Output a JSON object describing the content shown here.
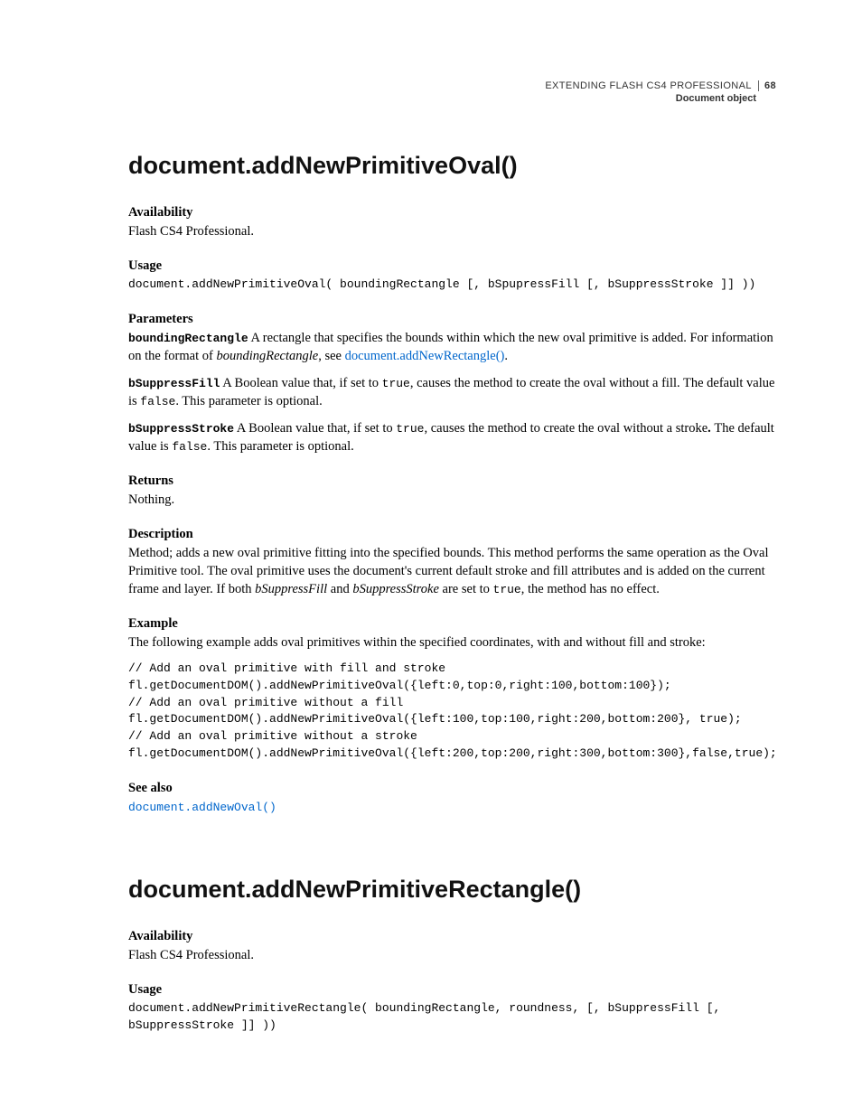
{
  "header": {
    "book_title": "EXTENDING FLASH CS4 PROFESSIONAL",
    "page_number": "68",
    "section": "Document object"
  },
  "method1": {
    "title": "document.addNewPrimitiveOval()",
    "availability_label": "Availability",
    "availability_text": "Flash CS4 Professional.",
    "usage_label": "Usage",
    "usage_code": "document.addNewPrimitiveOval( boundingRectangle [, bSpupressFill [, bSuppressStroke ]] ))",
    "parameters_label": "Parameters",
    "param1_name": "boundingRectangle",
    "param1_text_a": "  A rectangle that specifies the bounds within which the new oval primitive is added. For information on the format of ",
    "param1_boundingRect_ital": "boundingRectangle",
    "param1_text_b": ", see ",
    "param1_link": "document.addNewRectangle()",
    "param1_text_c": ".",
    "param2_name": "bSuppressFill",
    "param2_text_a": "  A Boolean value that, if set to ",
    "param2_true": "true",
    "param2_text_b": ", causes the method to create the oval without a fill. The default value is ",
    "param2_false": "false",
    "param2_text_c": ". This parameter is optional.",
    "param3_name": "bSuppressStroke",
    "param3_text_a": "  A Boolean value that, if set to ",
    "param3_true": "true",
    "param3_text_b": ", causes the method to create the oval without a stroke",
    "param3_period": ". ",
    "param3_text_c": "The default value is ",
    "param3_false": "false",
    "param3_text_d": ". This parameter is optional.",
    "returns_label": "Returns",
    "returns_text": "Nothing.",
    "description_label": "Description",
    "description_text_a": "Method; adds a new oval primitive fitting into the specified bounds. This method performs the same operation as the Oval Primitive tool. The oval primitive uses the document's current default stroke and fill attributes and is added on the current frame and layer. If both ",
    "description_ital1": "bSuppressFill",
    "description_text_b": " and ",
    "description_ital2": "bSuppressStroke",
    "description_text_c": " are set to ",
    "description_true": "true",
    "description_text_d": ", the method has no effect.",
    "example_label": "Example",
    "example_intro": "The following example adds oval primitives within the specified coordinates, with and without fill and stroke:",
    "example_code": "// Add an oval primitive with fill and stroke\nfl.getDocumentDOM().addNewPrimitiveOval({left:0,top:0,right:100,bottom:100});\n// Add an oval primitive without a fill\nfl.getDocumentDOM().addNewPrimitiveOval({left:100,top:100,right:200,bottom:200}, true);\n// Add an oval primitive without a stroke\nfl.getDocumentDOM().addNewPrimitiveOval({left:200,top:200,right:300,bottom:300},false,true);",
    "seealso_label": "See also",
    "seealso_link": "document.addNewOval()"
  },
  "method2": {
    "title": "document.addNewPrimitiveRectangle()",
    "availability_label": "Availability",
    "availability_text": "Flash CS4 Professional.",
    "usage_label": "Usage",
    "usage_code": "document.addNewPrimitiveRectangle( boundingRectangle, roundness, [, bSuppressFill [, bSuppressStroke ]] ))"
  }
}
